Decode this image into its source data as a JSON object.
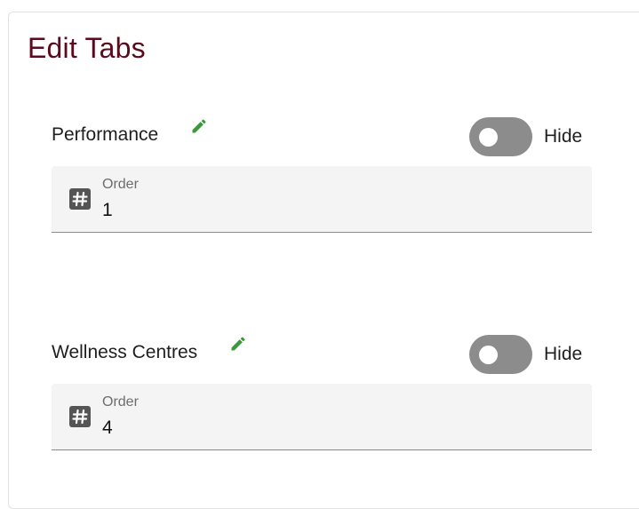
{
  "title": "Edit Tabs",
  "tabs": [
    {
      "name": "Performance",
      "hide_label": "Hide",
      "hidden": false,
      "order_label": "Order",
      "order_value": "1"
    },
    {
      "name": "Wellness Centres",
      "hide_label": "Hide",
      "hidden": false,
      "order_label": "Order",
      "order_value": "4"
    }
  ],
  "colors": {
    "title": "#5b0a1d",
    "edit_icon": "#3a9a3a",
    "toggle_off": "#8c8c8c",
    "field_background": "#f4f4f4"
  },
  "icons": {
    "edit": "pencil-icon",
    "order": "hash-icon"
  }
}
